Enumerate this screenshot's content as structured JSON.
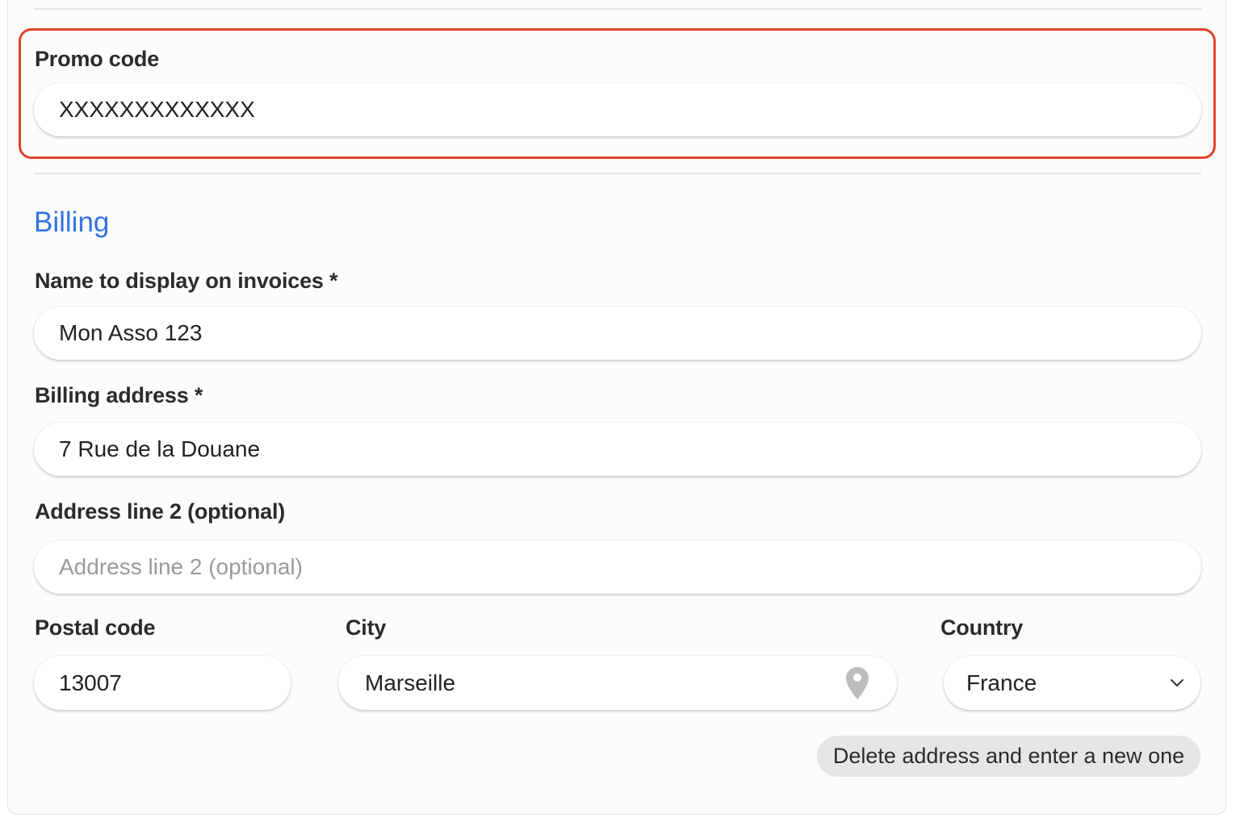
{
  "promo": {
    "label": "Promo code",
    "value": "XXXXXXXXXXXXX"
  },
  "billing": {
    "title": "Billing",
    "name": {
      "label": "Name to display on invoices *",
      "value": "Mon Asso 123"
    },
    "address": {
      "label": "Billing address *",
      "value": "7 Rue de la Douane"
    },
    "address2": {
      "label": "Address line 2 (optional)",
      "placeholder": "Address line 2 (optional)",
      "value": ""
    },
    "postal": {
      "label": "Postal code",
      "value": "13007"
    },
    "city": {
      "label": "City",
      "value": "Marseille",
      "icon": "map-pin-icon"
    },
    "country": {
      "label": "Country",
      "value": "France",
      "icon": "chevron-down-icon"
    },
    "delete_button": "Delete address and enter a new one"
  },
  "colors": {
    "accent": "#3572e4",
    "highlight_border": "#e0412b",
    "button_bg": "#e6e6e6"
  }
}
